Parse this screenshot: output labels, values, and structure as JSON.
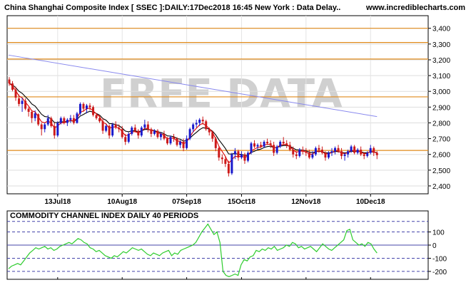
{
  "header": {
    "title": "China Shanghai Composite Index [ SSEC ]:DAILY:17Dec2018 16:45 New York : Data Delay..",
    "site": "www.incrediblecharts.com",
    "watermark": "FREE DATA"
  },
  "colors": {
    "background": "#ffffff",
    "panel_border": "#000000",
    "up_candle": "#1a1acc",
    "down_candle": "#cc1a1a",
    "horizontal_levels": "#e08a1a",
    "ma_fast": "#e00000",
    "ma_slow": "#000000",
    "ma_long": "#8888ee",
    "cci_line": "#2ecc2e",
    "cci_bands": "#4444aa",
    "watermark": "#d0d0d0"
  },
  "chart_data": [
    {
      "type": "candlestick",
      "ylim": [
        2350,
        3480
      ],
      "yticks": [
        2400,
        2500,
        2600,
        2700,
        2800,
        2900,
        3000,
        3100,
        3200,
        3300,
        3400
      ],
      "ytick_labels": [
        "2,400",
        "2,500",
        "2,600",
        "2,700",
        "2,800",
        "2,900",
        "3,000",
        "3,100",
        "3,200",
        "3,300",
        "3,400"
      ],
      "x_tick_labels": [
        {
          "label": "13Jul18",
          "bar": 15
        },
        {
          "label": "10Aug18",
          "bar": 35
        },
        {
          "label": "07Sep18",
          "bar": 55
        },
        {
          "label": "15Oct18",
          "bar": 72
        },
        {
          "label": "12Nov18",
          "bar": 92
        },
        {
          "label": "10Dec18",
          "bar": 112
        }
      ],
      "horizontal_levels": [
        3400,
        3310,
        3205,
        2965,
        2625
      ],
      "long_ma": {
        "start": 3230,
        "end": 2840
      },
      "ohlc": [
        [
          3075,
          3090,
          3035,
          3050
        ],
        [
          3050,
          3065,
          3000,
          3010
        ],
        [
          3010,
          3030,
          2940,
          2960
        ],
        [
          2955,
          2980,
          2905,
          2920
        ],
        [
          2920,
          2960,
          2870,
          2940
        ],
        [
          2940,
          2955,
          2880,
          2890
        ],
        [
          2890,
          2900,
          2840,
          2870
        ],
        [
          2870,
          2880,
          2800,
          2830
        ],
        [
          2830,
          2880,
          2810,
          2860
        ],
        [
          2855,
          2860,
          2780,
          2790
        ],
        [
          2790,
          2800,
          2720,
          2760
        ],
        [
          2760,
          2800,
          2740,
          2790
        ],
        [
          2790,
          2850,
          2780,
          2830
        ],
        [
          2830,
          2840,
          2770,
          2780
        ],
        [
          2780,
          2800,
          2700,
          2720
        ],
        [
          2720,
          2810,
          2710,
          2800
        ],
        [
          2800,
          2840,
          2790,
          2830
        ],
        [
          2830,
          2840,
          2790,
          2800
        ],
        [
          2800,
          2830,
          2780,
          2820
        ],
        [
          2820,
          2850,
          2800,
          2830
        ],
        [
          2830,
          2850,
          2790,
          2800
        ],
        [
          2800,
          2870,
          2795,
          2860
        ],
        [
          2860,
          2930,
          2850,
          2920
        ],
        [
          2920,
          2930,
          2870,
          2890
        ],
        [
          2890,
          2920,
          2860,
          2910
        ],
        [
          2910,
          2925,
          2880,
          2900
        ],
        [
          2900,
          2910,
          2840,
          2850
        ],
        [
          2850,
          2860,
          2820,
          2830
        ],
        [
          2830,
          2850,
          2800,
          2810
        ],
        [
          2810,
          2830,
          2730,
          2750
        ],
        [
          2750,
          2790,
          2740,
          2780
        ],
        [
          2780,
          2790,
          2700,
          2720
        ],
        [
          2720,
          2800,
          2710,
          2790
        ],
        [
          2790,
          2810,
          2760,
          2770
        ],
        [
          2770,
          2790,
          2740,
          2760
        ],
        [
          2760,
          2780,
          2700,
          2710
        ],
        [
          2710,
          2730,
          2660,
          2680
        ],
        [
          2680,
          2740,
          2670,
          2730
        ],
        [
          2730,
          2780,
          2720,
          2770
        ],
        [
          2770,
          2790,
          2740,
          2750
        ],
        [
          2750,
          2760,
          2700,
          2720
        ],
        [
          2720,
          2780,
          2710,
          2770
        ],
        [
          2770,
          2820,
          2760,
          2790
        ],
        [
          2790,
          2810,
          2740,
          2760
        ],
        [
          2760,
          2770,
          2710,
          2730
        ],
        [
          2730,
          2760,
          2720,
          2750
        ],
        [
          2750,
          2760,
          2700,
          2710
        ],
        [
          2710,
          2740,
          2690,
          2730
        ],
        [
          2730,
          2750,
          2690,
          2700
        ],
        [
          2700,
          2710,
          2660,
          2670
        ],
        [
          2670,
          2720,
          2660,
          2710
        ],
        [
          2710,
          2730,
          2680,
          2700
        ],
        [
          2700,
          2710,
          2650,
          2660
        ],
        [
          2660,
          2690,
          2640,
          2680
        ],
        [
          2680,
          2700,
          2620,
          2640
        ],
        [
          2640,
          2720,
          2630,
          2700
        ],
        [
          2700,
          2770,
          2690,
          2760
        ],
        [
          2760,
          2800,
          2740,
          2790
        ],
        [
          2790,
          2820,
          2770,
          2800
        ],
        [
          2800,
          2830,
          2780,
          2820
        ],
        [
          2820,
          2840,
          2790,
          2810
        ],
        [
          2810,
          2820,
          2750,
          2760
        ],
        [
          2760,
          2770,
          2720,
          2740
        ],
        [
          2740,
          2750,
          2680,
          2700
        ],
        [
          2700,
          2710,
          2620,
          2640
        ],
        [
          2640,
          2650,
          2560,
          2580
        ],
        [
          2580,
          2600,
          2540,
          2570
        ],
        [
          2570,
          2590,
          2520,
          2540
        ],
        [
          2540,
          2560,
          2460,
          2480
        ],
        [
          2480,
          2610,
          2470,
          2600
        ],
        [
          2600,
          2640,
          2570,
          2620
        ],
        [
          2620,
          2630,
          2560,
          2580
        ],
        [
          2580,
          2620,
          2570,
          2600
        ],
        [
          2600,
          2610,
          2540,
          2560
        ],
        [
          2560,
          2620,
          2550,
          2610
        ],
        [
          2610,
          2680,
          2600,
          2670
        ],
        [
          2670,
          2690,
          2640,
          2650
        ],
        [
          2650,
          2670,
          2630,
          2660
        ],
        [
          2660,
          2680,
          2640,
          2650
        ],
        [
          2650,
          2690,
          2640,
          2680
        ],
        [
          2680,
          2700,
          2660,
          2670
        ],
        [
          2670,
          2690,
          2640,
          2660
        ],
        [
          2660,
          2680,
          2590,
          2610
        ],
        [
          2610,
          2660,
          2600,
          2650
        ],
        [
          2650,
          2690,
          2640,
          2680
        ],
        [
          2680,
          2710,
          2660,
          2670
        ],
        [
          2670,
          2690,
          2640,
          2660
        ],
        [
          2660,
          2680,
          2620,
          2630
        ],
        [
          2630,
          2650,
          2580,
          2600
        ],
        [
          2600,
          2620,
          2570,
          2590
        ],
        [
          2590,
          2640,
          2580,
          2630
        ],
        [
          2630,
          2650,
          2600,
          2620
        ],
        [
          2620,
          2640,
          2590,
          2610
        ],
        [
          2610,
          2630,
          2570,
          2580
        ],
        [
          2580,
          2620,
          2570,
          2600
        ],
        [
          2600,
          2650,
          2590,
          2640
        ],
        [
          2640,
          2660,
          2610,
          2630
        ],
        [
          2630,
          2650,
          2600,
          2610
        ],
        [
          2610,
          2620,
          2560,
          2580
        ],
        [
          2580,
          2620,
          2570,
          2610
        ],
        [
          2610,
          2640,
          2590,
          2620
        ],
        [
          2620,
          2650,
          2600,
          2640
        ],
        [
          2640,
          2660,
          2610,
          2620
        ],
        [
          2620,
          2640,
          2570,
          2590
        ],
        [
          2590,
          2610,
          2560,
          2600
        ],
        [
          2600,
          2630,
          2580,
          2620
        ],
        [
          2620,
          2660,
          2610,
          2650
        ],
        [
          2650,
          2660,
          2600,
          2610
        ],
        [
          2610,
          2640,
          2600,
          2630
        ],
        [
          2630,
          2650,
          2590,
          2600
        ],
        [
          2600,
          2610,
          2570,
          2590
        ],
        [
          2590,
          2620,
          2580,
          2610
        ],
        [
          2610,
          2660,
          2600,
          2640
        ],
        [
          2640,
          2650,
          2590,
          2610
        ],
        [
          2610,
          2620,
          2570,
          2595
        ]
      ]
    },
    {
      "type": "line",
      "title": "COMMODITY CHANNEL INDEX DAILY 40 PERIODS",
      "ylim": [
        -260,
        260
      ],
      "yticks": [
        100,
        0,
        -100,
        -200
      ],
      "ytick_labels": [
        "100",
        "0",
        "-100",
        "-200"
      ],
      "reference_lines": [
        180,
        100,
        -100,
        -200
      ],
      "values": [
        -180,
        -160,
        -150,
        -140,
        -150,
        -120,
        -90,
        -60,
        -40,
        -20,
        -30,
        -20,
        -10,
        -30,
        -20,
        -40,
        -30,
        -10,
        0,
        10,
        20,
        10,
        30,
        50,
        40,
        20,
        10,
        -20,
        -30,
        -50,
        -40,
        -60,
        -80,
        -90,
        -100,
        -80,
        -90,
        -70,
        -50,
        -60,
        -40,
        -20,
        -30,
        -40,
        -30,
        -50,
        -70,
        -80,
        -60,
        -70,
        -80,
        -60,
        -50,
        -40,
        -80,
        -60,
        -70,
        -40,
        -30,
        -20,
        -10,
        0,
        20,
        60,
        100,
        130,
        160,
        120,
        80,
        100,
        20,
        -200,
        -230,
        -240,
        -230,
        -220,
        -230,
        -150,
        -110,
        -120,
        -90,
        -80,
        -40,
        -50,
        -30,
        -40,
        -20,
        -30,
        -10,
        -40,
        -30,
        -20,
        0,
        -10,
        20,
        10,
        -20,
        -10,
        -30,
        -20,
        -10,
        -30,
        -50,
        -20,
        10,
        -10,
        -30,
        -40,
        -20,
        0,
        20,
        40,
        110,
        120,
        40,
        20,
        0,
        10,
        -10,
        20,
        10,
        -30,
        -60
      ]
    }
  ]
}
